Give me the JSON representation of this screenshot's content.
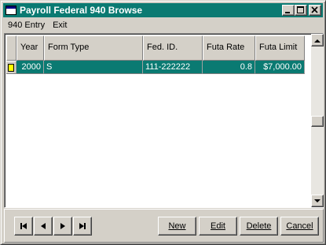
{
  "window": {
    "title": "Payroll Federal 940 Browse",
    "title_bar_color": "#0a7a72"
  },
  "menu": {
    "items": [
      {
        "label": "940 Entry"
      },
      {
        "label": "Exit"
      }
    ]
  },
  "grid": {
    "columns": [
      "Year",
      "Form Type",
      "Fed. ID.",
      "Futa Rate",
      "Futa Limit"
    ],
    "rows": [
      {
        "year": "2000",
        "form_type": "S",
        "fed_id": "111-222222",
        "futa_rate": "0.8",
        "futa_limit": "$7,000.00"
      }
    ],
    "selected_row_color": "#0a7a72"
  },
  "navigation": {
    "first_icon": "first-record-icon",
    "prev_icon": "previous-record-icon",
    "next_icon": "next-record-icon",
    "last_icon": "last-record-icon"
  },
  "actions": {
    "new_label": "New",
    "edit_label": "Edit",
    "delete_label": "Delete",
    "cancel_label": "Cancel"
  }
}
